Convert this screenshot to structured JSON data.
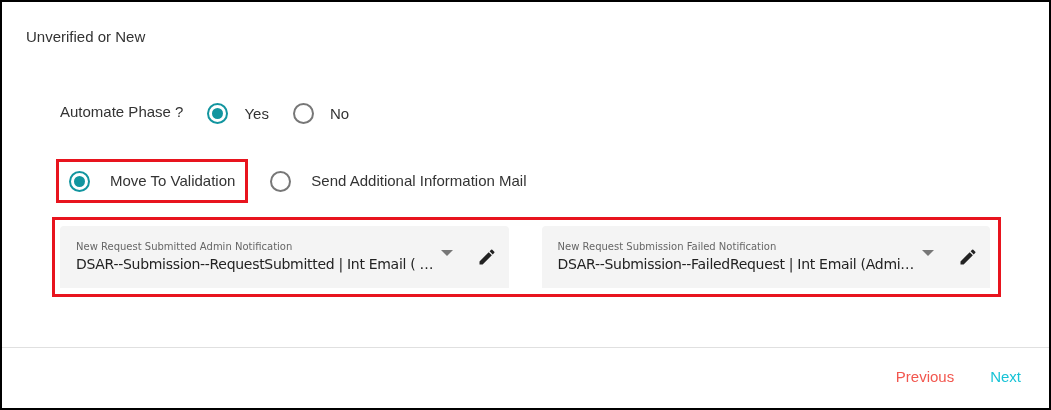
{
  "title": "Unverified or New",
  "automate": {
    "label": "Automate Phase ?",
    "options": [
      {
        "label": "Yes",
        "selected": true
      },
      {
        "label": "No",
        "selected": false
      }
    ]
  },
  "actions": {
    "options": [
      {
        "label": "Move To Validation",
        "selected": true,
        "highlighted": true
      },
      {
        "label": "Send Additional Information Mail",
        "selected": false,
        "highlighted": false
      }
    ]
  },
  "notifications": {
    "highlighted": true,
    "fields": [
      {
        "label": "New Request Submitted Admin Notification",
        "value": "DSAR--Submission--RequestSubmitted | Int Email ( …"
      },
      {
        "label": "New Request Submission Failed Notification",
        "value": "DSAR--Submission--FailedRequest | Int Email (Admi…"
      }
    ]
  },
  "footer": {
    "previous": "Previous",
    "next": "Next"
  }
}
